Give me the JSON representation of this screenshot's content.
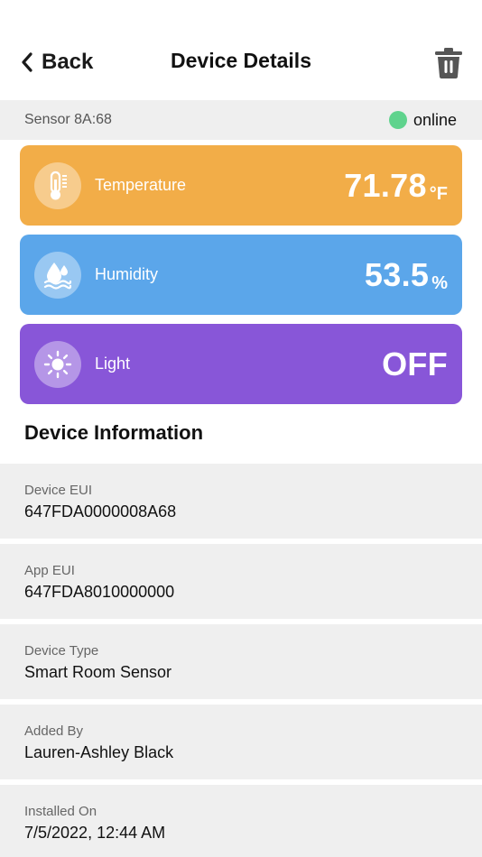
{
  "nav": {
    "back_label": "Back",
    "title": "Device Details",
    "back_icon": "chevron-left-icon",
    "delete_icon": "trash-icon"
  },
  "status": {
    "sensor_name": "Sensor 8A:68",
    "state": "online",
    "state_color": "#5fd38d"
  },
  "readings": [
    {
      "label": "Temperature",
      "value": "71.78",
      "unit": "°F",
      "icon": "thermometer-icon",
      "color": "#f2ad48"
    },
    {
      "label": "Humidity",
      "value": "53.5",
      "unit": "%",
      "icon": "water-drop-icon",
      "color": "#5ba6ea"
    },
    {
      "label": "Light",
      "value": "OFF",
      "unit": "",
      "icon": "sun-icon",
      "color": "#8856d8"
    }
  ],
  "info": {
    "title": "Device Information",
    "rows": [
      {
        "label": "Device EUI",
        "value": "647FDA0000008A68"
      },
      {
        "label": "App EUI",
        "value": "647FDA8010000000"
      },
      {
        "label": "Device Type",
        "value": "Smart Room Sensor"
      },
      {
        "label": "Added By",
        "value": "Lauren-Ashley Black"
      },
      {
        "label": "Installed On",
        "value": "7/5/2022, 12:44 AM"
      }
    ]
  }
}
